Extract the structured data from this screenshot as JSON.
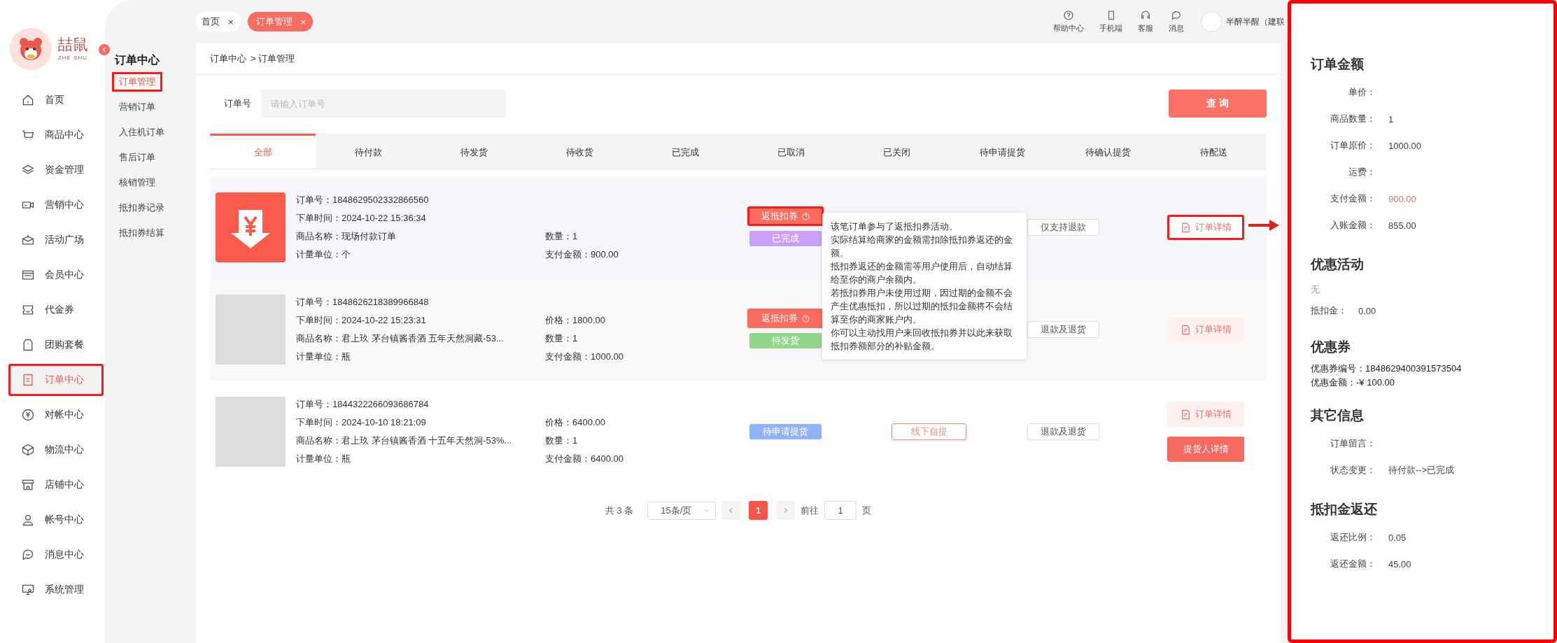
{
  "sidebar": {
    "logo": {
      "text": "喆鼠",
      "subtext": "ZHE SHU"
    },
    "items": [
      {
        "label": "首页",
        "selected": false,
        "highlighted": false
      },
      {
        "label": "商品中心",
        "selected": false,
        "highlighted": false
      },
      {
        "label": "资金管理",
        "selected": false,
        "highlighted": false
      },
      {
        "label": "营销中心",
        "selected": false,
        "highlighted": false
      },
      {
        "label": "活动广场",
        "selected": false,
        "highlighted": false
      },
      {
        "label": "会员中心",
        "selected": false,
        "highlighted": false
      },
      {
        "label": "代金券",
        "selected": false,
        "highlighted": false
      },
      {
        "label": "团购套餐",
        "selected": false,
        "highlighted": false
      },
      {
        "label": "订单中心",
        "selected": true,
        "highlighted": true
      },
      {
        "label": "对帐中心",
        "selected": false,
        "highlighted": false
      },
      {
        "label": "物流中心",
        "selected": false,
        "highlighted": false
      },
      {
        "label": "店铺中心",
        "selected": false,
        "highlighted": false
      },
      {
        "label": "帐号中心",
        "selected": false,
        "highlighted": false
      },
      {
        "label": "消息中心",
        "selected": false,
        "highlighted": false
      },
      {
        "label": "系统管理",
        "selected": false,
        "highlighted": false
      }
    ]
  },
  "submenu": {
    "title": "订单中心",
    "items": [
      {
        "label": "订单管理",
        "selected": true,
        "highlighted": true
      },
      {
        "label": "营销订单",
        "selected": false,
        "highlighted": false
      },
      {
        "label": "入住机订单",
        "selected": false,
        "highlighted": false
      },
      {
        "label": "售后订单",
        "selected": false,
        "highlighted": false
      },
      {
        "label": "核销管理",
        "selected": false,
        "highlighted": false
      },
      {
        "label": "抵扣券记录",
        "selected": false,
        "highlighted": false
      },
      {
        "label": "抵扣券结算",
        "selected": false,
        "highlighted": false
      }
    ]
  },
  "page_tabs": [
    {
      "label": "首页",
      "close": "×",
      "selected": false
    },
    {
      "label": "订单管理",
      "close": "×",
      "selected": true
    }
  ],
  "header_actions": [
    {
      "label": "帮助中心"
    },
    {
      "label": "手机端"
    },
    {
      "label": "客服"
    },
    {
      "label": "消息"
    }
  ],
  "user": {
    "name": "半醉半醒（建联"
  },
  "breadcrumb": [
    "订单中心",
    "> 订单管理"
  ],
  "search": {
    "label": "订单号",
    "placeholder": "请输入订单号",
    "button": "查 询"
  },
  "status_tabs": [
    {
      "label": "全部",
      "selected": true
    },
    {
      "label": "待付款",
      "selected": false
    },
    {
      "label": "待发货",
      "selected": false
    },
    {
      "label": "待收货",
      "selected": false
    },
    {
      "label": "已完成",
      "selected": false
    },
    {
      "label": "已取消",
      "selected": false
    },
    {
      "label": "已关闭",
      "selected": false
    },
    {
      "label": "待申请提货",
      "selected": false
    },
    {
      "label": "待确认提货",
      "selected": false
    },
    {
      "label": "待配送",
      "selected": false
    }
  ],
  "orders": [
    {
      "kind": "payment",
      "fields": [
        "订单号：1848629502332866560",
        "下单时间：2024-10-22 15:36:34",
        "商品名称：现场付款订单",
        "计量单位：个"
      ],
      "amounts": [
        "数量：1",
        "支付金额：900.00"
      ],
      "coupon_tag": {
        "label": "返抵扣券",
        "highlighted": true
      },
      "status": {
        "label": "已完成",
        "color": "#c9a2f7"
      },
      "refund": "仅支持退款",
      "actions": [
        {
          "label": "订单详情",
          "kind": "detail",
          "highlighted": true
        }
      ],
      "tooltip": [
        "该笔订单参与了返抵扣券活动。",
        "实际结算给商家的金额需扣除抵扣券返还的金额。",
        "抵扣券返还的金额需等用户使用后，自动结算给至你的商户余额内。",
        "若抵扣券用户未使用过期，因过期的金额不会产生优惠抵扣，所以过期的抵扣金额将不会结算至你的商家账户内。",
        "你可以主动找用户来回收抵扣券并以此来获取抵扣券额部分的补贴金额。"
      ]
    },
    {
      "kind": "product",
      "fields": [
        "订单号：1848626218389966848",
        "下单时间：2024-10-22 15:23:31",
        "商品名称：君上玖 茅台镇酱香酒 五年天然洞藏-53...",
        "计量单位：瓶"
      ],
      "amounts": [
        "价格：1800.00",
        "数量：1",
        "支付金额：1000.00"
      ],
      "coupon_tag": {
        "label": "返抵扣券",
        "highlighted": false
      },
      "status": {
        "label": "待发货",
        "color": "#92d68c"
      },
      "refund": "退款及退货",
      "actions": [
        {
          "label": "订单详情",
          "kind": "detail",
          "highlighted": false
        }
      ]
    },
    {
      "kind": "product",
      "fields": [
        "订单号：1844322266093686784",
        "下单时间：2024-10-10 18:21:09",
        "商品名称：君上玖 茅台镇酱香酒 十五年天然洞-53%...",
        "计量单位：瓶"
      ],
      "amounts": [
        "价格：6400.00",
        "数量：1",
        "支付金额：6400.00"
      ],
      "status": {
        "label": "待申请提货",
        "color": "#8fb3f5"
      },
      "delivery": "线下自提",
      "refund": "退款及退货",
      "actions": [
        {
          "label": "订单详情",
          "kind": "detail",
          "highlighted": false
        },
        {
          "label": "提货人详情",
          "kind": "primary"
        }
      ]
    }
  ],
  "pagination": {
    "total": "共 3 条",
    "page_size": "15条/页",
    "pages": [
      {
        "label": "1",
        "selected": true
      }
    ],
    "goto_label": "前往",
    "goto_value": "1",
    "goto_suffix": "页"
  },
  "detail_panel": {
    "sections": [
      {
        "title": "订单金额",
        "items": [
          {
            "kind": "field",
            "label": "单价："
          },
          {
            "kind": "field",
            "label": "商品数量：",
            "value": "1"
          },
          {
            "kind": "field",
            "label": "订单原价：",
            "value": "1000.00"
          },
          {
            "kind": "field",
            "label": "运费："
          },
          {
            "kind": "field",
            "label": "支付金额：",
            "value": "900.00",
            "highlight": true
          },
          {
            "kind": "field",
            "label": "入账金额：",
            "value": "855.00"
          }
        ]
      },
      {
        "title": "优惠活动",
        "items": [
          {
            "kind": "note",
            "value": "无"
          },
          {
            "kind": "inline",
            "label": "抵扣金：",
            "value": "0.00"
          }
        ]
      },
      {
        "title": "优惠券",
        "items": [
          {
            "kind": "compact",
            "label": "优惠券编号：",
            "value": "1848629400391573504"
          },
          {
            "kind": "compact",
            "label": "优惠金额：",
            "value": "-¥ 100.00"
          }
        ]
      },
      {
        "title": "其它信息",
        "items": [
          {
            "kind": "field",
            "label": "订单留言："
          },
          {
            "kind": "field",
            "label": "状态变更：",
            "value": "待付款-->已完成"
          }
        ]
      },
      {
        "title": "抵扣金返还",
        "items": [
          {
            "kind": "field",
            "label": "返还比例：",
            "value": "0.05"
          },
          {
            "kind": "field",
            "label": "返还金额：",
            "value": "45.00"
          }
        ]
      }
    ]
  }
}
